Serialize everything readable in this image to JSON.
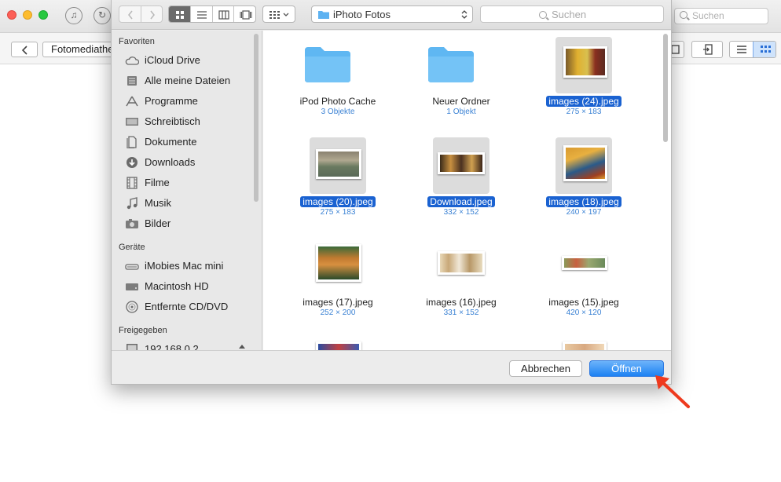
{
  "app": {
    "search_placeholder": "Suchen",
    "breadcrumb_label": "Fotomediathek"
  },
  "dialog": {
    "path_label": "iPhoto  Fotos",
    "search_placeholder": "Suchen",
    "sidebar": {
      "sections": [
        {
          "title": "Favoriten"
        },
        {
          "title": "Geräte"
        },
        {
          "title": "Freigegeben"
        }
      ],
      "favorites": [
        {
          "label": "iCloud Drive",
          "icon": "cloud-icon"
        },
        {
          "label": "Alle meine Dateien",
          "icon": "all-files-icon"
        },
        {
          "label": "Programme",
          "icon": "applications-icon"
        },
        {
          "label": "Schreibtisch",
          "icon": "desktop-icon"
        },
        {
          "label": "Dokumente",
          "icon": "document-icon"
        },
        {
          "label": "Downloads",
          "icon": "download-icon"
        },
        {
          "label": "Filme",
          "icon": "film-icon"
        },
        {
          "label": "Musik",
          "icon": "music-icon"
        },
        {
          "label": "Bilder",
          "icon": "camera-icon"
        }
      ],
      "devices": [
        {
          "label": "iMobies Mac mini",
          "icon": "mac-mini-icon"
        },
        {
          "label": "Macintosh HD",
          "icon": "hard-drive-icon"
        },
        {
          "label": "Entfernte CD/DVD",
          "icon": "disc-icon"
        }
      ],
      "shared": [
        {
          "label": "192.168.0.2",
          "icon": "network-computer-icon"
        }
      ]
    },
    "items": [
      {
        "name": "iPod Photo Cache",
        "meta": "3 Objekte",
        "kind": "folder",
        "selected": false
      },
      {
        "name": "Neuer Ordner",
        "meta": "1 Objekt",
        "kind": "folder",
        "selected": false
      },
      {
        "name": "images (24).jpeg",
        "meta": "275 × 183",
        "kind": "image",
        "selected": true
      },
      {
        "name": "images (20).jpeg",
        "meta": "275 × 183",
        "kind": "image",
        "selected": true
      },
      {
        "name": "Download.jpeg",
        "meta": "332 × 152",
        "kind": "image",
        "selected": true
      },
      {
        "name": "images (18).jpeg",
        "meta": "240 × 197",
        "kind": "image",
        "selected": true
      },
      {
        "name": "images (17).jpeg",
        "meta": "252 × 200",
        "kind": "image",
        "selected": false
      },
      {
        "name": "images (16).jpeg",
        "meta": "331 × 152",
        "kind": "image",
        "selected": false
      },
      {
        "name": "images (15).jpeg",
        "meta": "420 × 120",
        "kind": "image",
        "selected": false
      }
    ],
    "buttons": {
      "cancel": "Abbrechen",
      "open": "Öffnen"
    }
  },
  "colors": {
    "accent_blue": "#1d82f3",
    "selection_blue": "#1a62d1",
    "annotation_arrow": "#ee3a1e"
  }
}
